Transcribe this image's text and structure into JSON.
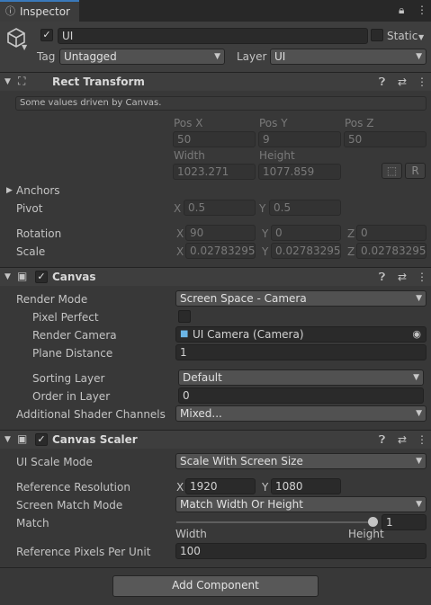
{
  "tab": {
    "title": "Inspector"
  },
  "object": {
    "name": "UI",
    "static_label": "Static",
    "tag_label": "Tag",
    "tag_value": "Untagged",
    "layer_label": "Layer",
    "layer_value": "UI"
  },
  "rect_transform": {
    "title": "Rect Transform",
    "note": "Some values driven by Canvas.",
    "pos_x_label": "Pos X",
    "pos_y_label": "Pos Y",
    "pos_z_label": "Pos Z",
    "pos_x": "50",
    "pos_y": "9",
    "pos_z": "50",
    "width_label": "Width",
    "height_label": "Height",
    "width": "1023.271",
    "height": "1077.859",
    "r_button": "R",
    "anchors_label": "Anchors",
    "pivot_label": "Pivot",
    "pivot_x": "0.5",
    "pivot_y": "0.5",
    "rotation_label": "Rotation",
    "rot_x": "90",
    "rot_y": "0",
    "rot_z": "0",
    "scale_label": "Scale",
    "scale_x": "0.02783295",
    "scale_y": "0.02783295",
    "scale_z": "0.02783295",
    "x": "X",
    "y": "Y",
    "z": "Z"
  },
  "canvas": {
    "title": "Canvas",
    "render_mode_label": "Render Mode",
    "render_mode": "Screen Space - Camera",
    "pixel_perfect_label": "Pixel Perfect",
    "render_camera_label": "Render Camera",
    "render_camera": "UI Camera (Camera)",
    "plane_distance_label": "Plane Distance",
    "plane_distance": "1",
    "sorting_layer_label": "Sorting Layer",
    "sorting_layer": "Default",
    "order_label": "Order in Layer",
    "order": "0",
    "shader_channels_label": "Additional Shader Channels",
    "shader_channels": "Mixed..."
  },
  "canvas_scaler": {
    "title": "Canvas Scaler",
    "scale_mode_label": "UI Scale Mode",
    "scale_mode": "Scale With Screen Size",
    "ref_res_label": "Reference Resolution",
    "ref_x": "1920",
    "ref_y": "1080",
    "match_mode_label": "Screen Match Mode",
    "match_mode": "Match Width Or Height",
    "match_label": "Match",
    "match_value": "1",
    "width_end": "Width",
    "height_end": "Height",
    "ppu_label": "Reference Pixels Per Unit",
    "ppu": "100"
  },
  "add_component": "Add Component",
  "icons": [
    "lock-icon",
    "kebab-menu-icon",
    "gameobject-cube-icon",
    "rect-transform-icon",
    "canvas-icon",
    "help-icon",
    "preset-icon",
    "camera-icon",
    "target-picker-icon"
  ]
}
